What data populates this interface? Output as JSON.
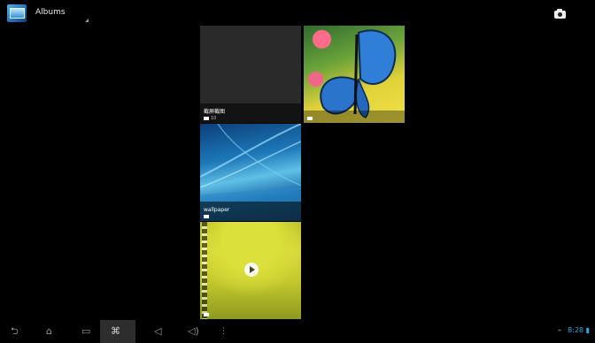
{
  "actionbar": {
    "title": "Albums",
    "icon": "gallery-icon",
    "camera_icon": "camera-icon"
  },
  "albums": [
    {
      "name": "截屏截图",
      "count": "10",
      "type": "image"
    },
    {
      "name": "",
      "count": "",
      "type": "image"
    },
    {
      "name": "wallpaper",
      "count": "",
      "type": "image"
    },
    {
      "name": "",
      "count": "",
      "type": "video"
    }
  ],
  "navbar": {
    "back": "⮌",
    "home": "⌂",
    "recent": "▭",
    "screenshot": "⌘",
    "vol_down": "◁",
    "vol_up": "◁)",
    "menu": "⋮"
  },
  "status": {
    "usb": "⌁",
    "time": "8:28",
    "battery": "▮"
  },
  "colors": {
    "background": "#000000",
    "status_accent": "#2fa6e0"
  }
}
